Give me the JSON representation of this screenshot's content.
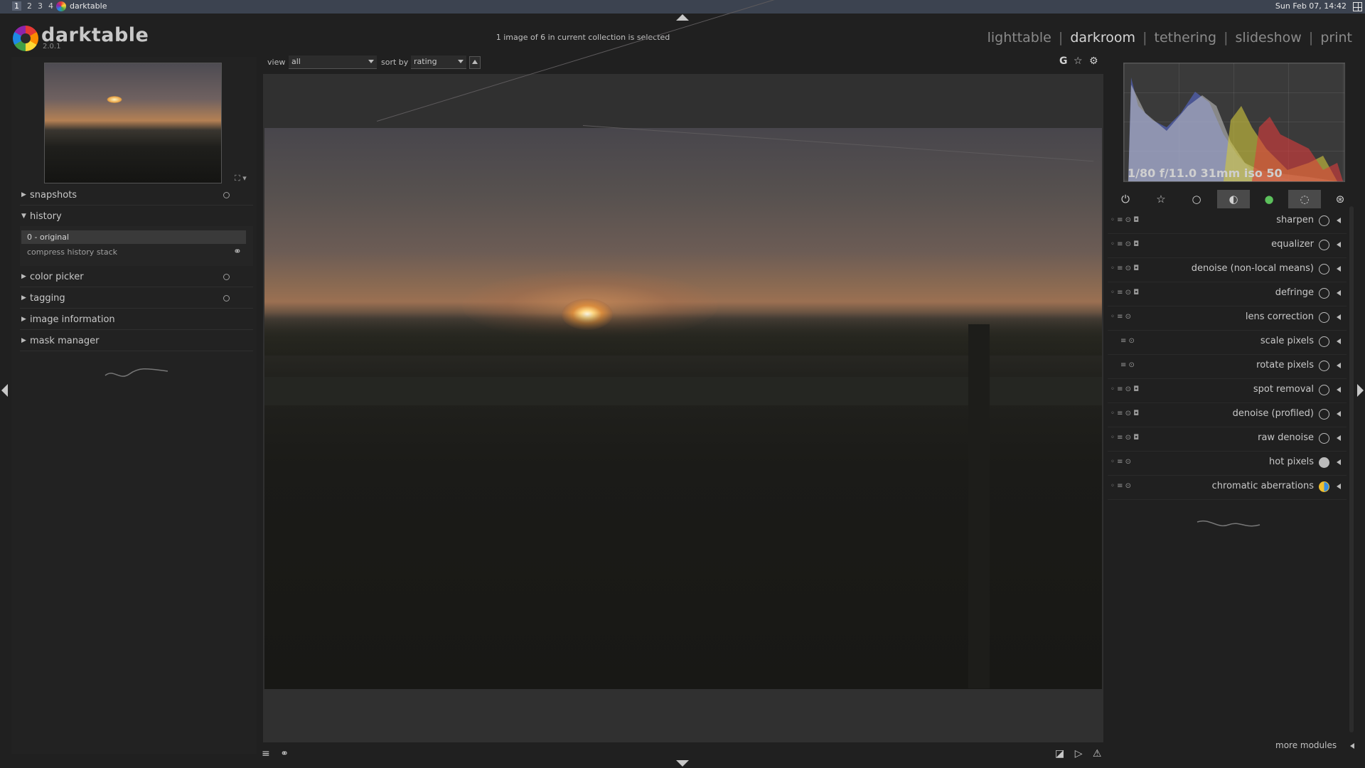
{
  "os_bar": {
    "workspaces": [
      "1",
      "2",
      "3",
      "4"
    ],
    "active_workspace": "1",
    "window_title": "darktable",
    "clock": "Sun Feb 07, 14:42"
  },
  "header": {
    "app_name": "darktable",
    "version": "2.0.1",
    "status": "1 image of 6 in current collection is selected",
    "views": [
      "lighttable",
      "darkroom",
      "tethering",
      "slideshow",
      "print"
    ],
    "active_view": "darkroom",
    "separator": "|"
  },
  "left_panel": {
    "sections": [
      {
        "label": "snapshots",
        "expanded": false,
        "has_reset": true
      },
      {
        "label": "history",
        "expanded": true,
        "has_reset": false
      },
      {
        "label": "color picker",
        "expanded": false,
        "has_reset": true
      },
      {
        "label": "tagging",
        "expanded": false,
        "has_reset": true
      },
      {
        "label": "image information",
        "expanded": false,
        "has_reset": false
      },
      {
        "label": "mask manager",
        "expanded": false,
        "has_reset": false
      }
    ],
    "history_items": [
      "0 - original"
    ],
    "compress_label": "compress history stack"
  },
  "toolbar": {
    "view_label": "view",
    "view_value": "all",
    "sort_label": "sort by",
    "sort_value": "rating",
    "top_icons": [
      "G",
      "☆",
      "⚙"
    ]
  },
  "right_panel": {
    "exif": "1/80 f/11.0 31mm iso 50",
    "group_icons": [
      "power-icon",
      "favorites-icon",
      "basic-icon",
      "tone-icon",
      "color-icon",
      "correct-icon",
      "effect-icon"
    ],
    "active_group": 3,
    "modules": [
      {
        "name": "sharpen",
        "icon": "hand"
      },
      {
        "name": "equalizer",
        "icon": "hand"
      },
      {
        "name": "denoise (non-local means)",
        "icon": "preset"
      },
      {
        "name": "defringe",
        "icon": "circle"
      },
      {
        "name": "lens correction",
        "icon": "preset"
      },
      {
        "name": "scale pixels",
        "icon": "circle"
      },
      {
        "name": "rotate pixels",
        "icon": "circle"
      },
      {
        "name": "spot removal",
        "icon": "preset"
      },
      {
        "name": "denoise (profiled)",
        "icon": "circle"
      },
      {
        "name": "raw denoise",
        "icon": "preset"
      },
      {
        "name": "hot pixels",
        "icon": "preset"
      },
      {
        "name": "chromatic aberrations",
        "icon": "color"
      }
    ],
    "more_modules": "more modules"
  },
  "colors": {
    "background": "#202020",
    "panel": "#222222",
    "text": "#c8c8c8",
    "accent_yellow": "#f0c030"
  }
}
